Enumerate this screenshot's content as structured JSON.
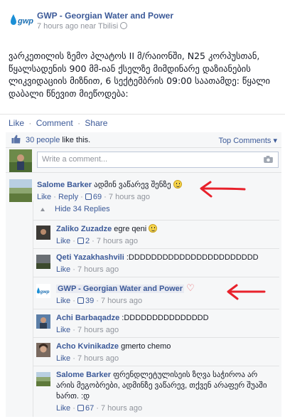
{
  "post": {
    "page_name": "GWP - Georgian Water and Power",
    "meta": "7 hours ago near Tbilisi",
    "body": "ვარკეთილის ზემო პლატოს II მ/რაიონში, N25 კორპუსთან, წყალსადენის 900 მმ-იან ქსელზე მიმდინარე დაზიანების ლიკვიდაციის მიზნით, 6 სექტემბრის 09:00 საათამდე: წყალი დაბალი წნევით მიეწოდება:"
  },
  "actions": {
    "like": "Like",
    "comment": "Comment",
    "share": "Share",
    "sep": "·"
  },
  "likes": {
    "count_text": "30 people",
    "suffix": " like this.",
    "top_comments": "Top Comments ▾"
  },
  "write": {
    "placeholder": "Write a comment..."
  },
  "top_comment": {
    "name": "Salome Barker",
    "text": " ადმინ ვაწარევ შენზე ",
    "like": "Like",
    "reply": "Reply",
    "likes": "69",
    "time": "7 hours ago"
  },
  "hide_replies": "Hide 34 Replies",
  "replies": [
    {
      "name": "Zaliko Zuzadze",
      "text": " egre qeni ",
      "like": "Like",
      "likes": "2",
      "time": "7 hours ago"
    },
    {
      "name": "Qeti Yazakhashvili",
      "text": " :DDDDDDDDDDDDDDDDDDDDDDD",
      "like": "Like",
      "likes": "",
      "time": "7 hours ago"
    },
    {
      "name": "GWP - Georgian Water and Power",
      "text": "",
      "like": "Like",
      "likes": "39",
      "time": "7 hours ago"
    },
    {
      "name": "Achi Barbaqadze",
      "text": " :DDDDDDDDDDDDDDD",
      "like": "Like",
      "likes": "",
      "time": "7 hours ago"
    },
    {
      "name": "Acho Kvinikadze",
      "text": " gmerto chemo",
      "like": "Like",
      "likes": "",
      "time": "7 hours ago"
    },
    {
      "name": "Salome Barker",
      "text": " ფრენდლეტულისეის ზღვა საჭიროა არ არის მეგობრები, ადმინზე ვაწარევ, თქვენ არაფერ შუაში ხართ. :დ",
      "like": "Like",
      "likes": "67",
      "time": "7 hours ago"
    }
  ],
  "colors": {
    "link": "#3b5998",
    "arrow": "#e8212b"
  }
}
